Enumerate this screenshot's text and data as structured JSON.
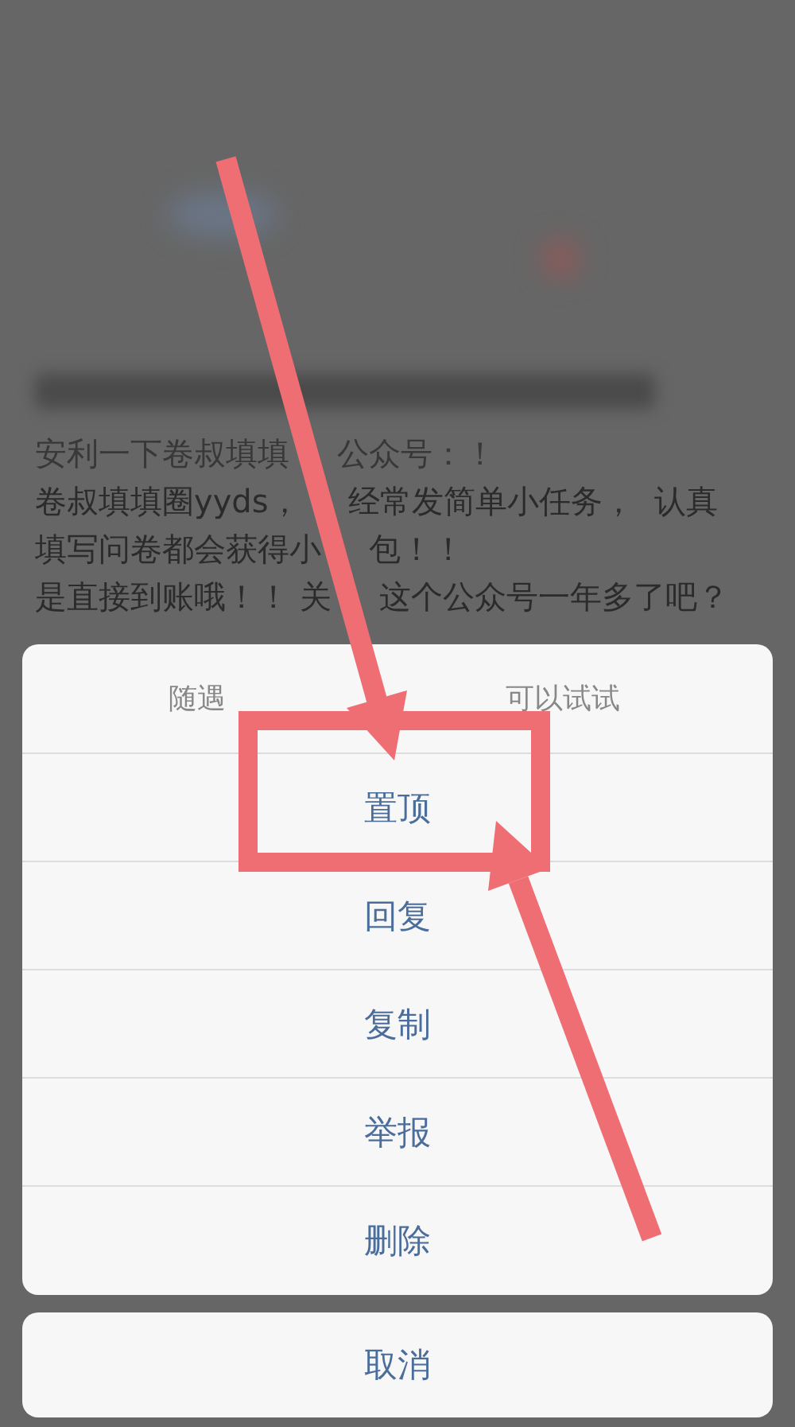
{
  "post": {
    "lines": [
      [
        "安利一下卷叔填填",
        "公众号：！"
      ],
      [
        "卷叔填填圈yyds，",
        "经常发简单小任务，  认真"
      ],
      [
        "填写问卷都会获得小",
        "包！！"
      ],
      [
        "是直接到账哦！！ 关",
        "这个公众号一年多了吧？"
      ]
    ]
  },
  "action_sheet": {
    "header": [
      "随遇",
      "可以试试"
    ],
    "items": [
      {
        "label": "置顶",
        "highlighted": true
      },
      {
        "label": "回复",
        "highlighted": false
      },
      {
        "label": "复制",
        "highlighted": false
      },
      {
        "label": "举报",
        "highlighted": false
      },
      {
        "label": "删除",
        "highlighted": false
      }
    ],
    "cancel": "取消"
  }
}
